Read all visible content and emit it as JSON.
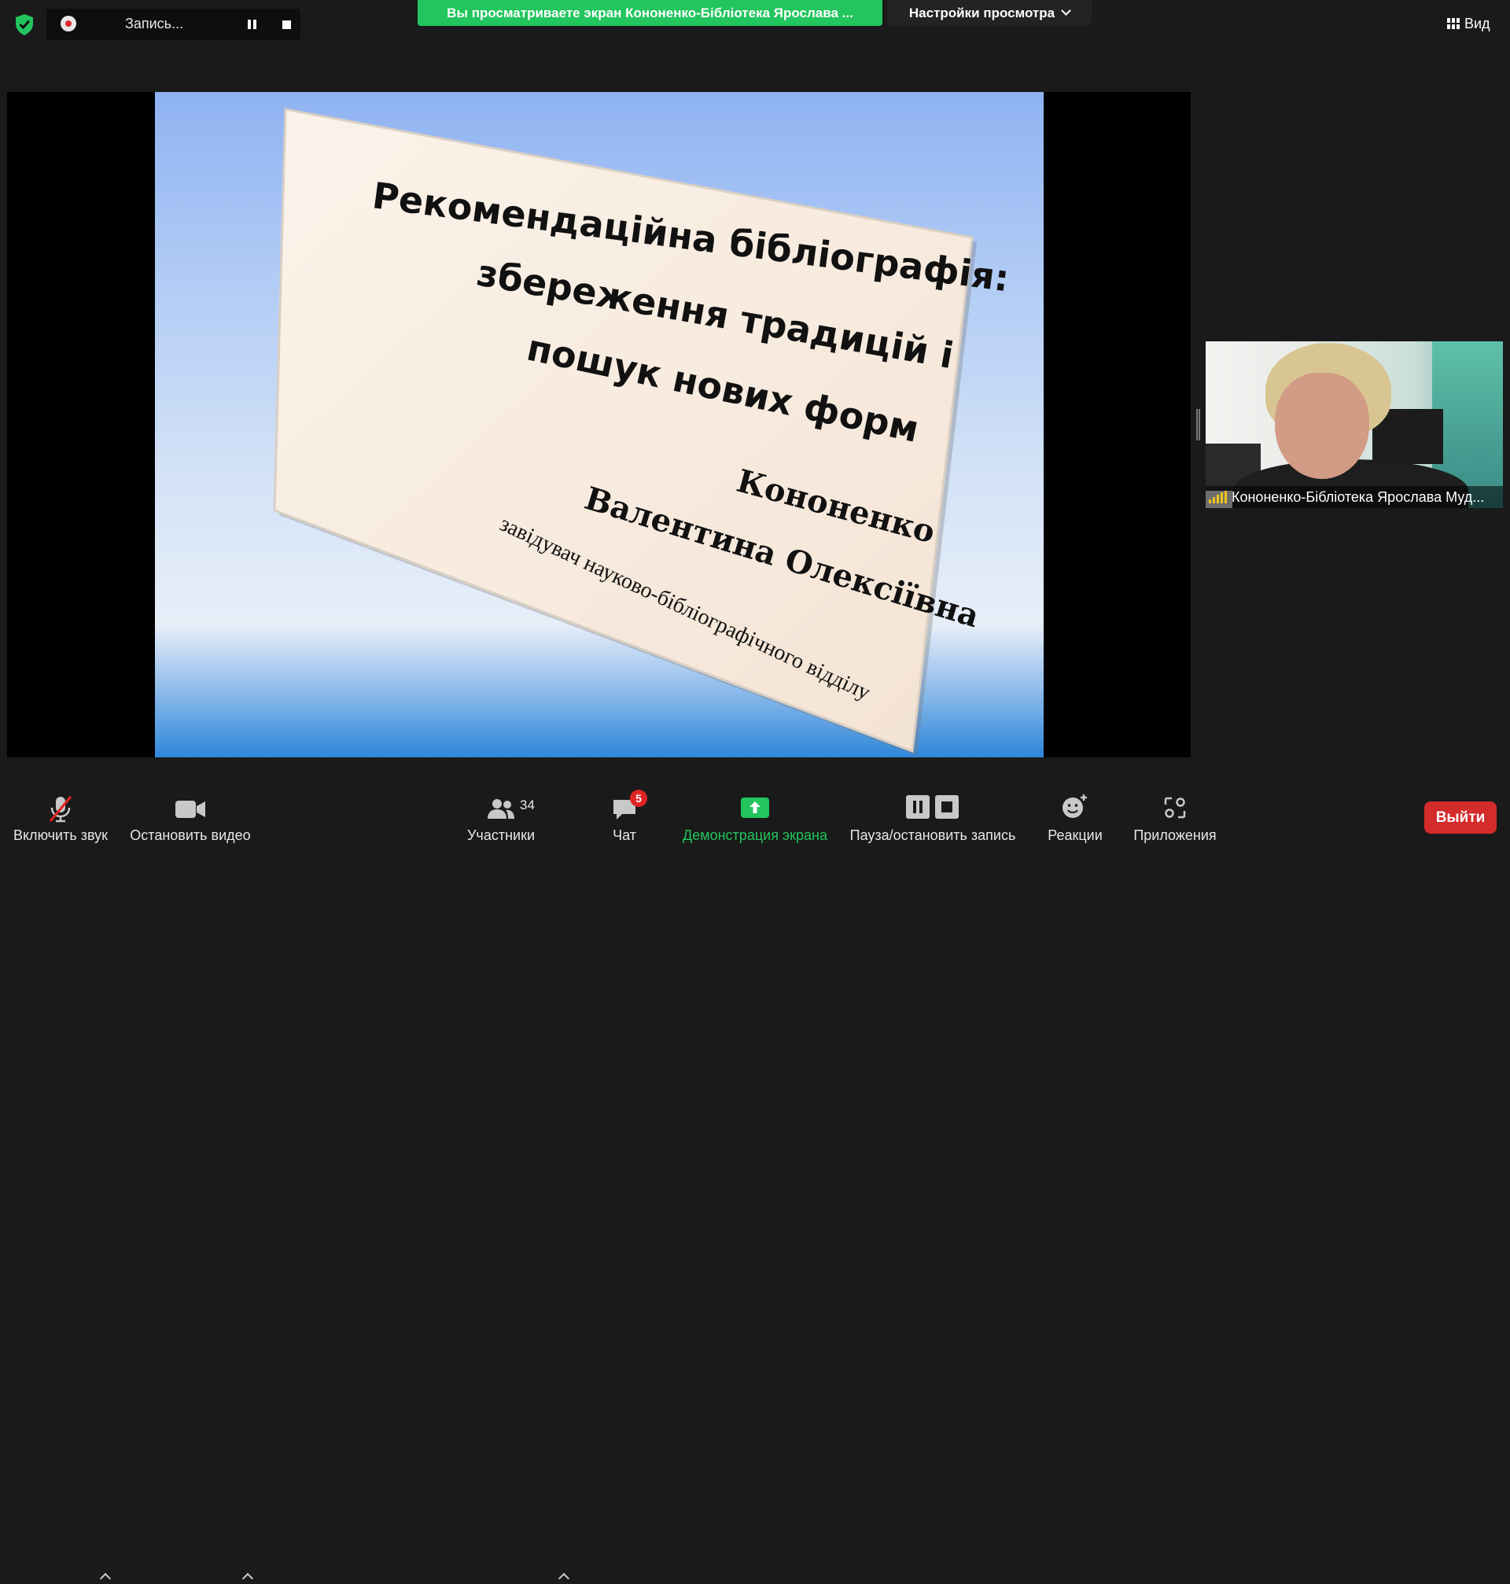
{
  "recording": {
    "label": "Запись..."
  },
  "share_banner": {
    "text": "Вы просматриваете экран Кононенко-Бібліотека Ярослава ..."
  },
  "view_settings": {
    "label": "Настройки просмотра"
  },
  "view_button": {
    "label": "Вид"
  },
  "slide": {
    "title_lines": [
      "Рекомендаційна бібліографія:",
      "збереження традицій і",
      "пошук нових форм"
    ],
    "author_lines": [
      "Кононенко",
      "Валентина Олексіївна"
    ],
    "position": "завідувач науково-бібліографічного відділу"
  },
  "participant": {
    "name": "Кононенко-Бібліотека Ярослава Муд..."
  },
  "toolbar": {
    "mute_label": "Включить звук",
    "video_label": "Остановить видео",
    "participants_label": "Участники",
    "participants_count": "34",
    "chat_label": "Чат",
    "chat_badge": "5",
    "share_label": "Демонстрация экрана",
    "record_label": "Пауза/остановить запись",
    "reactions_label": "Реакции",
    "apps_label": "Приложения",
    "leave_label": "Выйти"
  },
  "colors": {
    "share_green": "#22c55e",
    "leave_red": "#d42b2b",
    "background": "#1a1a1a"
  }
}
